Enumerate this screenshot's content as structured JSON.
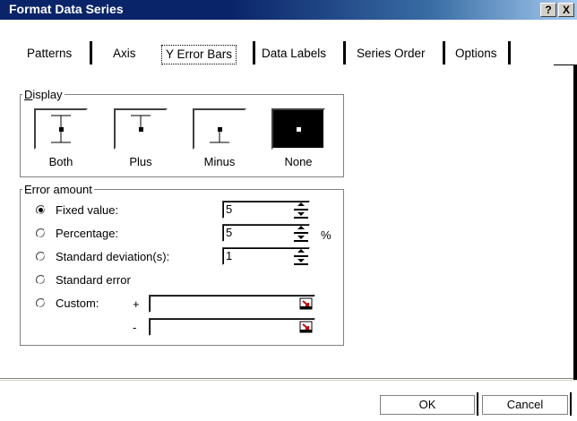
{
  "window": {
    "title": "Format Data Series",
    "help_button": "?",
    "close_button": "X"
  },
  "tabs": [
    {
      "label": "Patterns",
      "active": false
    },
    {
      "label": "Axis",
      "active": false
    },
    {
      "label": "Y Error Bars",
      "active": true
    },
    {
      "label": "Data Labels",
      "active": false
    },
    {
      "label": "Series Order",
      "active": false
    },
    {
      "label": "Options",
      "active": false
    }
  ],
  "display": {
    "group_label": "Display",
    "options": [
      {
        "label": "Both",
        "icon": "error-bar-both-icon",
        "selected": false
      },
      {
        "label": "Plus",
        "icon": "error-bar-plus-icon",
        "selected": false
      },
      {
        "label": "Minus",
        "icon": "error-bar-minus-icon",
        "selected": false
      },
      {
        "label": "None",
        "icon": "error-bar-none-icon",
        "selected": true
      }
    ]
  },
  "error_amount": {
    "group_label": "Error amount",
    "options": [
      {
        "label": "Fixed value:",
        "selected": true,
        "value": "5",
        "unit": ""
      },
      {
        "label": "Percentage:",
        "selected": false,
        "value": "5",
        "unit": "%"
      },
      {
        "label": "Standard deviation(s):",
        "selected": false,
        "value": "1",
        "unit": ""
      },
      {
        "label": "Standard error",
        "selected": false
      },
      {
        "label": "Custom:",
        "selected": false
      }
    ],
    "custom": {
      "plus_sign": "+",
      "minus_sign": "-",
      "plus_value": "",
      "minus_value": ""
    }
  },
  "buttons": {
    "ok": "OK",
    "cancel": "Cancel"
  },
  "colors": {
    "title_bar": "#0a246a",
    "ref_icon_accent": "#cc0000"
  }
}
